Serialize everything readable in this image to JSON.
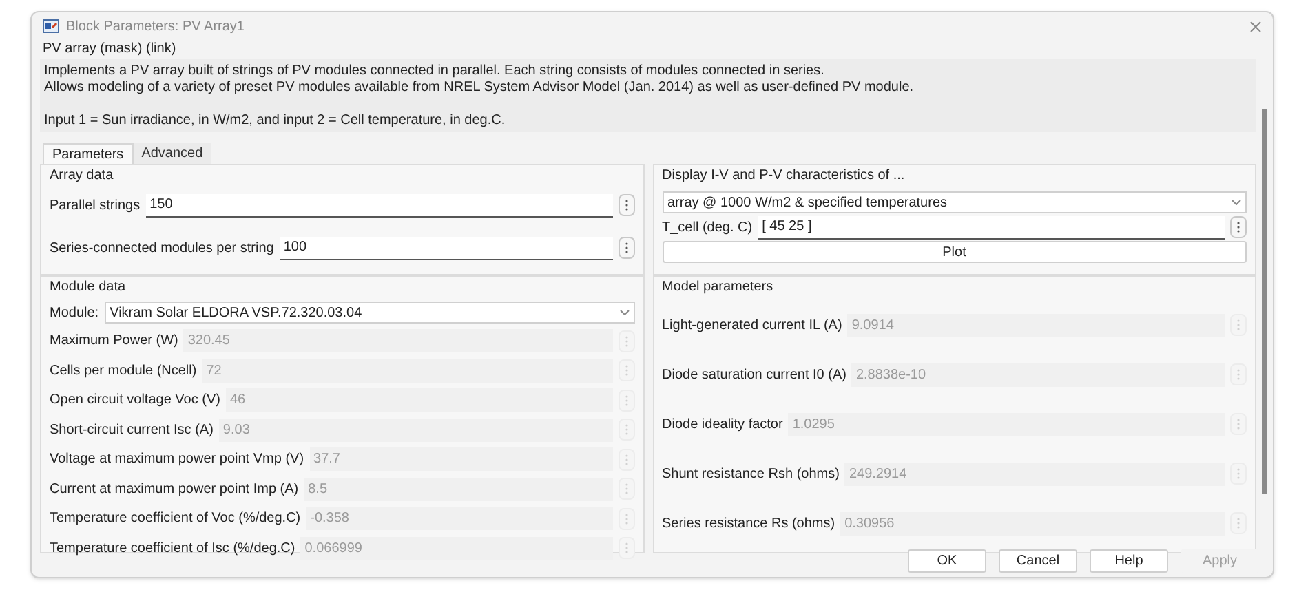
{
  "window": {
    "title": "Block Parameters: PV Array1"
  },
  "header": "PV array (mask) (link)",
  "description": [
    "Implements a PV array built of strings of PV modules connected in parallel. Each string consists of modules connected in series.",
    "Allows modeling of a variety of preset PV modules available from NREL System Advisor Model (Jan. 2014) as well as user-defined PV module.",
    "Input 1 = Sun irradiance, in W/m2, and input 2 = Cell temperature, in deg.C."
  ],
  "tabs": [
    {
      "label": "Parameters",
      "selected": true
    },
    {
      "label": "Advanced",
      "selected": false
    }
  ],
  "array_data": {
    "title": "Array data",
    "fields": [
      {
        "label": "Parallel strings",
        "value": "150",
        "disabled": false
      },
      {
        "label": "Series-connected modules per string",
        "value": "100",
        "disabled": false
      }
    ]
  },
  "display": {
    "title": "Display  I-V and P-V characteristics of ...",
    "dropdown": "array @ 1000 W/m2 & specified temperatures",
    "field": {
      "label": "T_cell (deg. C)",
      "value": "[ 45 25  ]",
      "disabled": false
    },
    "button": "Plot"
  },
  "module_data": {
    "title": "Module data",
    "module_label": "Module:",
    "module_value": "Vikram Solar ELDORA VSP.72.320.03.04",
    "fields": [
      {
        "label": "Maximum Power (W)",
        "value": "320.45",
        "disabled": true
      },
      {
        "label": "Cells per module (Ncell)",
        "value": "72",
        "disabled": true
      },
      {
        "label": "Open circuit voltage  Voc (V)",
        "value": "46",
        "disabled": true
      },
      {
        "label": "Short-circuit current Isc (A)",
        "value": "9.03",
        "disabled": true
      },
      {
        "label": "Voltage at maximum power point Vmp (V)",
        "value": "37.7",
        "disabled": true
      },
      {
        "label": "Current at maximum power point Imp (A)",
        "value": "8.5",
        "disabled": true
      },
      {
        "label": "Temperature coefficient of Voc (%/deg.C)",
        "value": "-0.358",
        "disabled": true
      },
      {
        "label": "Temperature coefficient of Isc (%/deg.C)",
        "value": "0.066999",
        "disabled": true
      }
    ]
  },
  "model_parameters": {
    "title": "Model parameters",
    "fields": [
      {
        "label": "Light-generated current IL (A)",
        "value": "9.0914",
        "disabled": true
      },
      {
        "label": "Diode saturation current I0 (A)",
        "value": "2.8838e-10",
        "disabled": true
      },
      {
        "label": "Diode ideality factor",
        "value": "1.0295",
        "disabled": true
      },
      {
        "label": "Shunt resistance Rsh (ohms)",
        "value": "249.2914",
        "disabled": true
      },
      {
        "label": "Series resistance Rs (ohms)",
        "value": "0.30956",
        "disabled": true
      }
    ]
  },
  "buttons": [
    {
      "label": "OK",
      "disabled": false
    },
    {
      "label": "Cancel",
      "disabled": false
    },
    {
      "label": "Help",
      "disabled": false
    },
    {
      "label": "Apply",
      "disabled": true
    }
  ]
}
